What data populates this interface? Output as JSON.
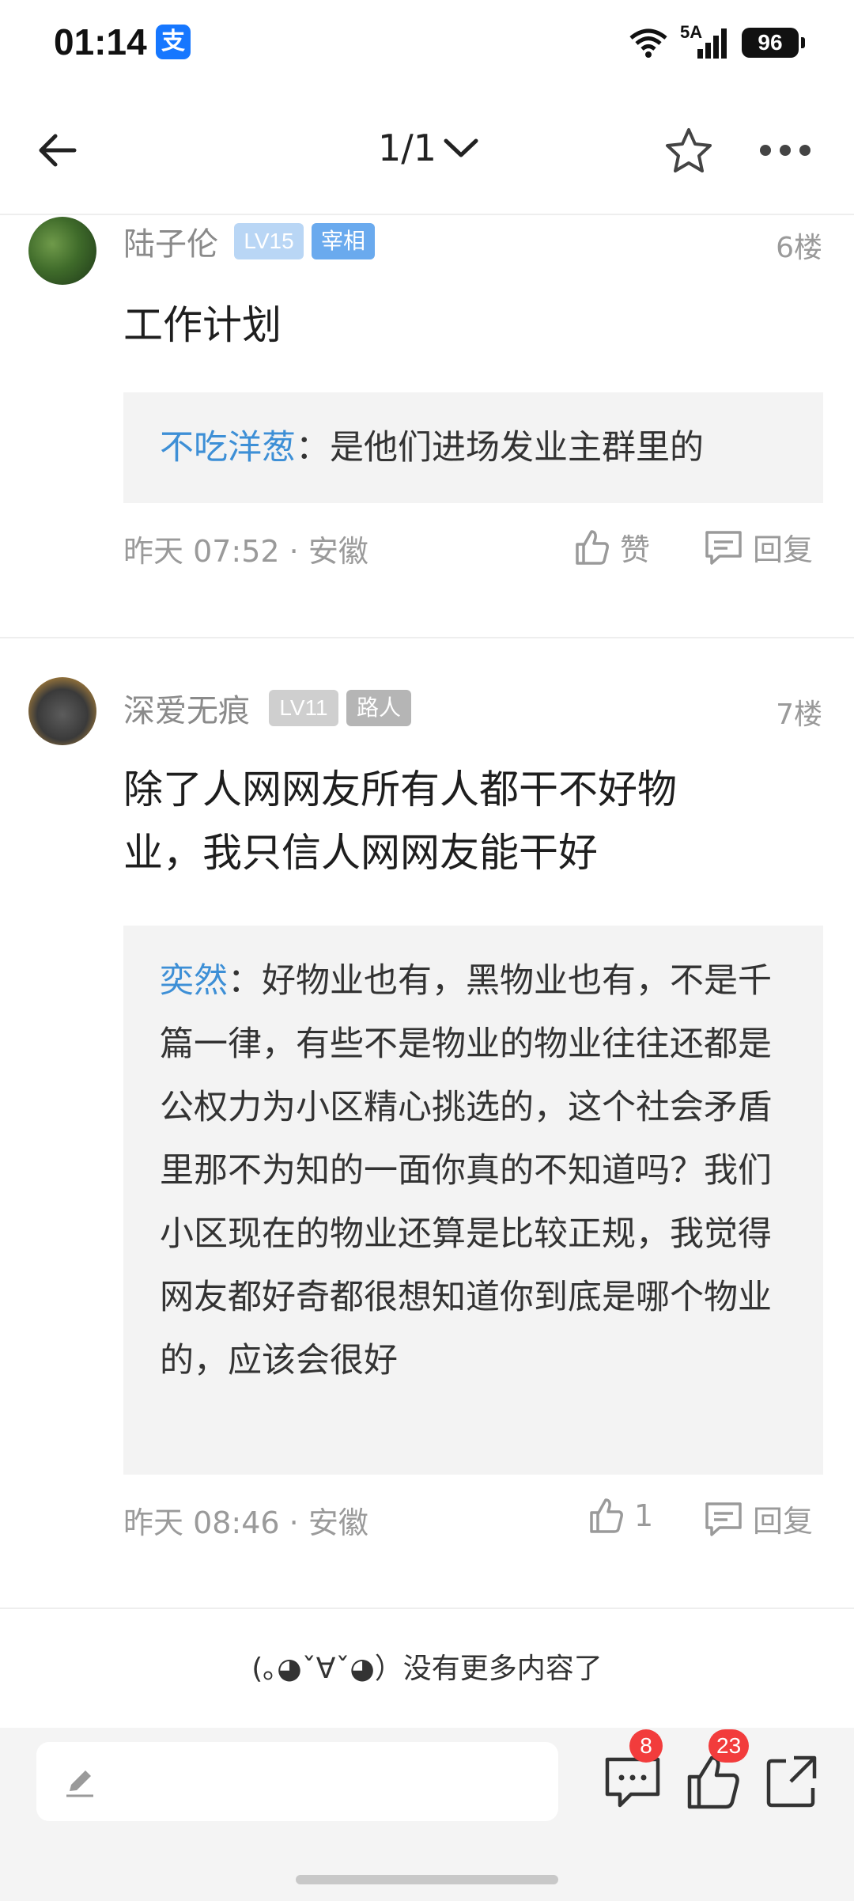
{
  "status_bar": {
    "time": "01:14",
    "alipay_icon": "支",
    "network": "5A",
    "battery": "96"
  },
  "nav": {
    "page_indicator": "1/1"
  },
  "posts": [
    {
      "username": "陆子伦",
      "level": "LV15",
      "rank": "宰相",
      "floor": "6楼",
      "content": "工作计划",
      "quote_user": "不吃洋葱",
      "quote_text": "：是他们进场发业主群里的",
      "time": "昨天 07:52 · 安徽",
      "like_label": "赞",
      "reply_label": "回复"
    },
    {
      "username": "深爱无痕",
      "level": "LV11",
      "rank": "路人",
      "floor": "7楼",
      "content": "除了人网网友所有人都干不好物业，我只信人网网友能干好",
      "quote_user": "奕然",
      "quote_text": "：好物业也有，黑物业也有，不是千篇一律，有些不是物业的物业往往还都是公权力为小区精心挑选的，这个社会矛盾里那不为知的一面你真的不知道吗？我们小区现在的物业还算是比较正规，我觉得网友都好奇都很想知道你到底是哪个物业的，应该会很好",
      "time": "昨天 08:46 · 安徽",
      "like_label": "1",
      "reply_label": "回复"
    }
  ],
  "end_message": "(｡◕ˇ∀ˇ◕）没有更多内容了",
  "bottom_bar": {
    "comment_count": "8",
    "like_count": "23"
  },
  "colors": {
    "link_blue": "#3d8fd6",
    "badge_red": "#f23c3c",
    "lv15_badge": "#b9d6f5",
    "rank_blue": "#6aaaee",
    "lv11_badge": "#cfcfcf",
    "rank_grey": "#b5b5b5"
  },
  "icons": [
    "back-arrow-icon",
    "chevron-down-icon",
    "star-icon",
    "more-icon",
    "thumbs-up-icon",
    "reply-icon",
    "pencil-icon",
    "comment-icon",
    "share-icon",
    "wifi-icon",
    "signal-icon"
  ]
}
